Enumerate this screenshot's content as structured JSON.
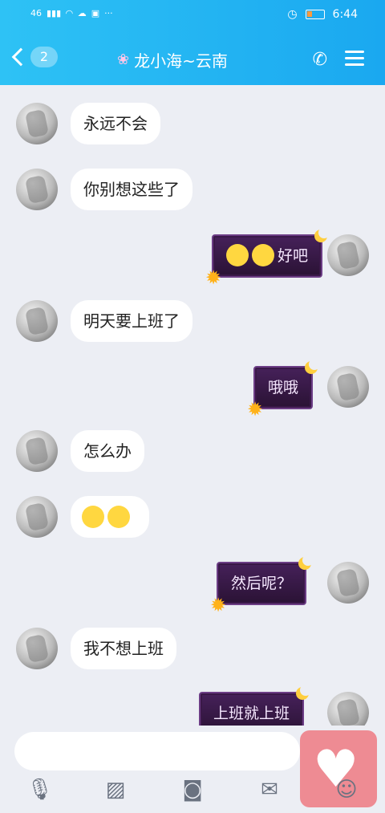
{
  "status": {
    "signal": "46",
    "time": "6:44"
  },
  "header": {
    "unread_count": "2",
    "title": "龙小海~云南"
  },
  "messages": [
    {
      "side": "left",
      "text": "永远不会"
    },
    {
      "side": "left",
      "text": "你别想这些了"
    },
    {
      "side": "right",
      "text": "好吧",
      "emojis": 2
    },
    {
      "side": "left",
      "text": "明天要上班了"
    },
    {
      "side": "right",
      "text": "哦哦"
    },
    {
      "side": "left",
      "text": "怎么办"
    },
    {
      "side": "left",
      "text": "",
      "emojis": 2
    },
    {
      "side": "right",
      "text": "然后呢？"
    },
    {
      "side": "left",
      "text": "我不想上班"
    },
    {
      "side": "right",
      "text": "上班就上班"
    }
  ],
  "input": {
    "placeholder": ""
  },
  "toolbar": {
    "icons": [
      "mic-icon",
      "image-icon",
      "camera-icon",
      "red-packet-icon",
      "emoji-icon"
    ]
  },
  "colors": {
    "header_start": "#2ec2f5",
    "header_end": "#1aa8f0",
    "bubble_dark": "#46215a",
    "fab": "#ee8b93"
  }
}
